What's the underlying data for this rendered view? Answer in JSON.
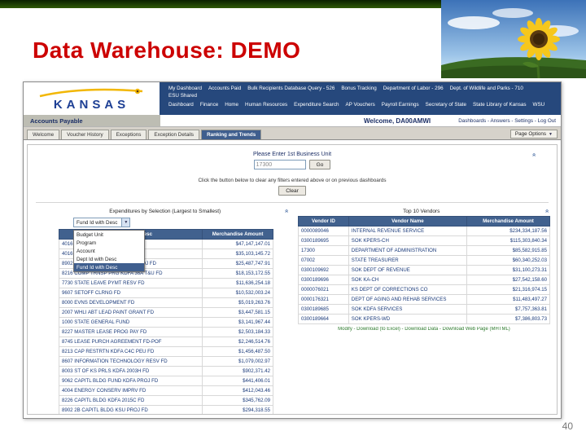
{
  "slide": {
    "title": "Data Warehouse:  DEMO",
    "page_number": "40"
  },
  "colors": {
    "title_red": "#cc0000",
    "nav_navy": "#26487c",
    "table_header_navy": "#41618e",
    "footer_link_green": "#2c7a2c",
    "top_strip_green": "#1e3d02"
  },
  "logo": {
    "text": "KANSAS"
  },
  "nav": {
    "row1": [
      "My Dashboard",
      "Accounts Paid",
      "Bulk Recipients Database Query - 526",
      "Bonus Tracking",
      "Department of Labor - 296",
      "Dept. of Wildlife and Parks - 710",
      "ESU Shared"
    ],
    "row2": [
      "Dashboard",
      "Finance",
      "Home",
      "Human Resources",
      "Expenditure Search",
      "AP Vouchers",
      "Payroll Earnings",
      "Secretary of State",
      "State Library of Kansas",
      "WSU"
    ]
  },
  "banner": {
    "section": "Accounts Payable",
    "welcome": "Welcome, DA00AMWI",
    "links": [
      "Dashboards",
      "Answers",
      "Settings",
      "Log Out"
    ]
  },
  "tabs": {
    "items": [
      "Welcome",
      "Voucher History",
      "Exceptions",
      "Exception Details",
      "Ranking and Trends"
    ],
    "active": "Ranking and Trends",
    "page_options": "Page Options"
  },
  "prompt": {
    "label": "Please Enter 1st Business Unit",
    "value": "17300",
    "go": "Go",
    "clear_text": "Click the button below to clear any filters entered above or on previous dashboards",
    "clear": "Clear"
  },
  "left_panel": {
    "title": "Expenditures by Selection (Largest to Smallest)",
    "dropdown_selected": "Fund Id with Desc",
    "dropdown_options": [
      "Budget Unit",
      "Program",
      "Account",
      "Dept Id with Desc",
      "Fund Id with Desc"
    ],
    "columns": [
      "Fund Id with Desc",
      "Merchandise Amount"
    ],
    "rows": [
      [
        "4016 MUNIS BOND PAYMT FD",
        "$47,147,147.01"
      ],
      [
        "4016 REPAIR BLDG FUND",
        "$35,103,145.72"
      ],
      [
        "8902 2B CAPITL BLDG KU/KSU PROJ FD",
        "$25,487,747.91"
      ],
      [
        "8216 COMP TRNSP PRG KDFA 36A T&U FD",
        "$18,153,172.55"
      ],
      [
        "7730 STATE LEAVE PYMT RESV FD",
        "$11,636,254.18"
      ],
      [
        "9607 SETOFF CLRNG FD",
        "$10,532,003.24"
      ],
      [
        "8000 EVNS DEVELOPMENT FD",
        "$5,019,263.76"
      ],
      [
        "2007 WHLI ABT LEAD PAINT GRANT FD",
        "$3,447,581.15"
      ],
      [
        "1000 STATE GENERAL FUND",
        "$3,141,967.44"
      ],
      [
        "8227 MASTER LEASE PROG PAY FD",
        "$2,503,184.33"
      ],
      [
        "8745 LEASE PURCH AGREEMENT FD-POF",
        "$2,246,514.76"
      ],
      [
        "8213 CAP RESTRTN KDFA C4C PEU FD",
        "$1,456,487.50"
      ],
      [
        "8607 INFORMATION TECHNOLOGY RESV FD",
        "$1,079,002.97"
      ],
      [
        "8003 ST OF KS PRLS KDFA 2003H FD",
        "$902,371.42"
      ],
      [
        "9062 CAPITL BLDG FUND KDFA PROJ FD",
        "$441,406.01"
      ],
      [
        "4004 ENERGY CONSERV IMPRV FD",
        "$412,043.46"
      ],
      [
        "8226 CAPITL BLDG KDFA 2015C FD",
        "$345,762.09"
      ],
      [
        "8902 2B CAPITL BLDG KSU PROJ FD",
        "$294,318.55"
      ]
    ]
  },
  "right_panel": {
    "title": "Top 10 Vendors",
    "columns": [
      "Vendor ID",
      "Vendor Name",
      "Merchandise Amount"
    ],
    "rows": [
      [
        "0000089046",
        "INTERNAL REVENUE SERVICE",
        "$234,334,187.56"
      ],
      [
        "0300189695",
        "SOK KPERS-CH",
        "$115,303,840.34"
      ],
      [
        "17300",
        "DEPARTMENT OF ADMINISTRATION",
        "$85,582,915.85"
      ],
      [
        "07002",
        "STATE TREASURER",
        "$60,340,252.03"
      ],
      [
        "0300109692",
        "SOK DEPT OF REVENUE",
        "$31,100,273.31"
      ],
      [
        "0300189696",
        "SOK KA-CH",
        "$27,542,158.60"
      ],
      [
        "0000076021",
        "KS DEPT OF CORRECTIONS CO",
        "$21,316,974.15"
      ],
      [
        "0000176321",
        "DEPT OF AGING AND REHAB SERVICES",
        "$11,483,497.27"
      ],
      [
        "0300189685",
        "SOK KDFA SERVICES",
        "$7,757,363.81"
      ],
      [
        "0300189664",
        "SOK KPERS-WD",
        "$7,386,803.73"
      ]
    ],
    "footer": "Modify - Download (to Excel) - Download Data - Download Web Page (MHTML)"
  }
}
